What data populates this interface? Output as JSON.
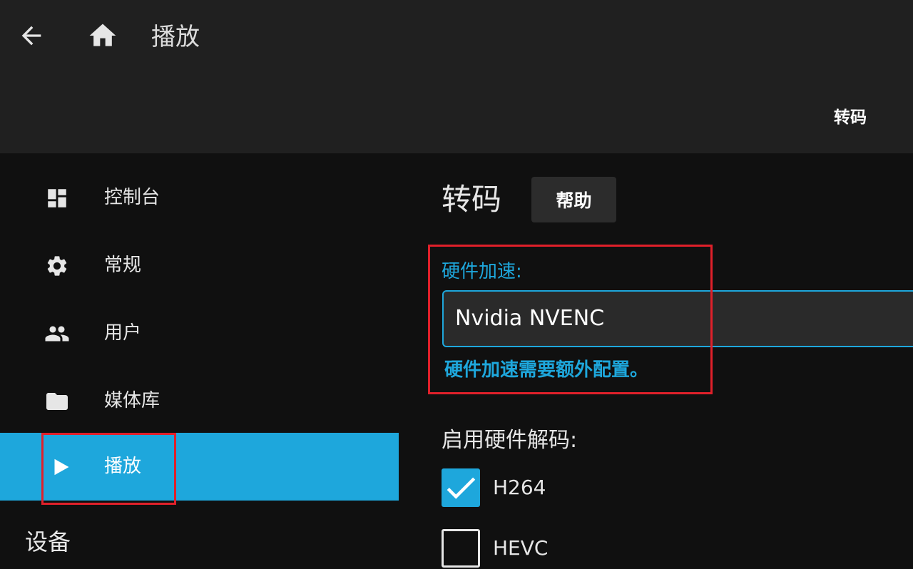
{
  "header": {
    "title": "播放",
    "tab_label": "转码",
    "back_icon": "arrow-left-icon",
    "home_icon": "home-icon"
  },
  "sidebar": {
    "items": [
      {
        "label": "控制台",
        "icon": "dashboard-icon"
      },
      {
        "label": "常规",
        "icon": "gear-icon"
      },
      {
        "label": "用户",
        "icon": "people-icon"
      },
      {
        "label": "媒体库",
        "icon": "folder-icon"
      },
      {
        "label": "播放",
        "icon": "play-icon",
        "active": true
      }
    ],
    "section_heading": "设备"
  },
  "main": {
    "title": "转码",
    "help_label": "帮助",
    "hw_accel_label": "硬件加速:",
    "hw_accel_value": "Nvidia NVENC",
    "hw_accel_note": "硬件加速需要额外配置。",
    "hw_decode_label": "启用硬件解码:",
    "codecs": [
      {
        "label": "H264",
        "checked": true
      },
      {
        "label": "HEVC",
        "checked": false
      }
    ]
  },
  "colors": {
    "accent": "#1ea7dc",
    "header_bg": "#202020",
    "page_bg": "#101010",
    "highlight": "#e0202a"
  }
}
